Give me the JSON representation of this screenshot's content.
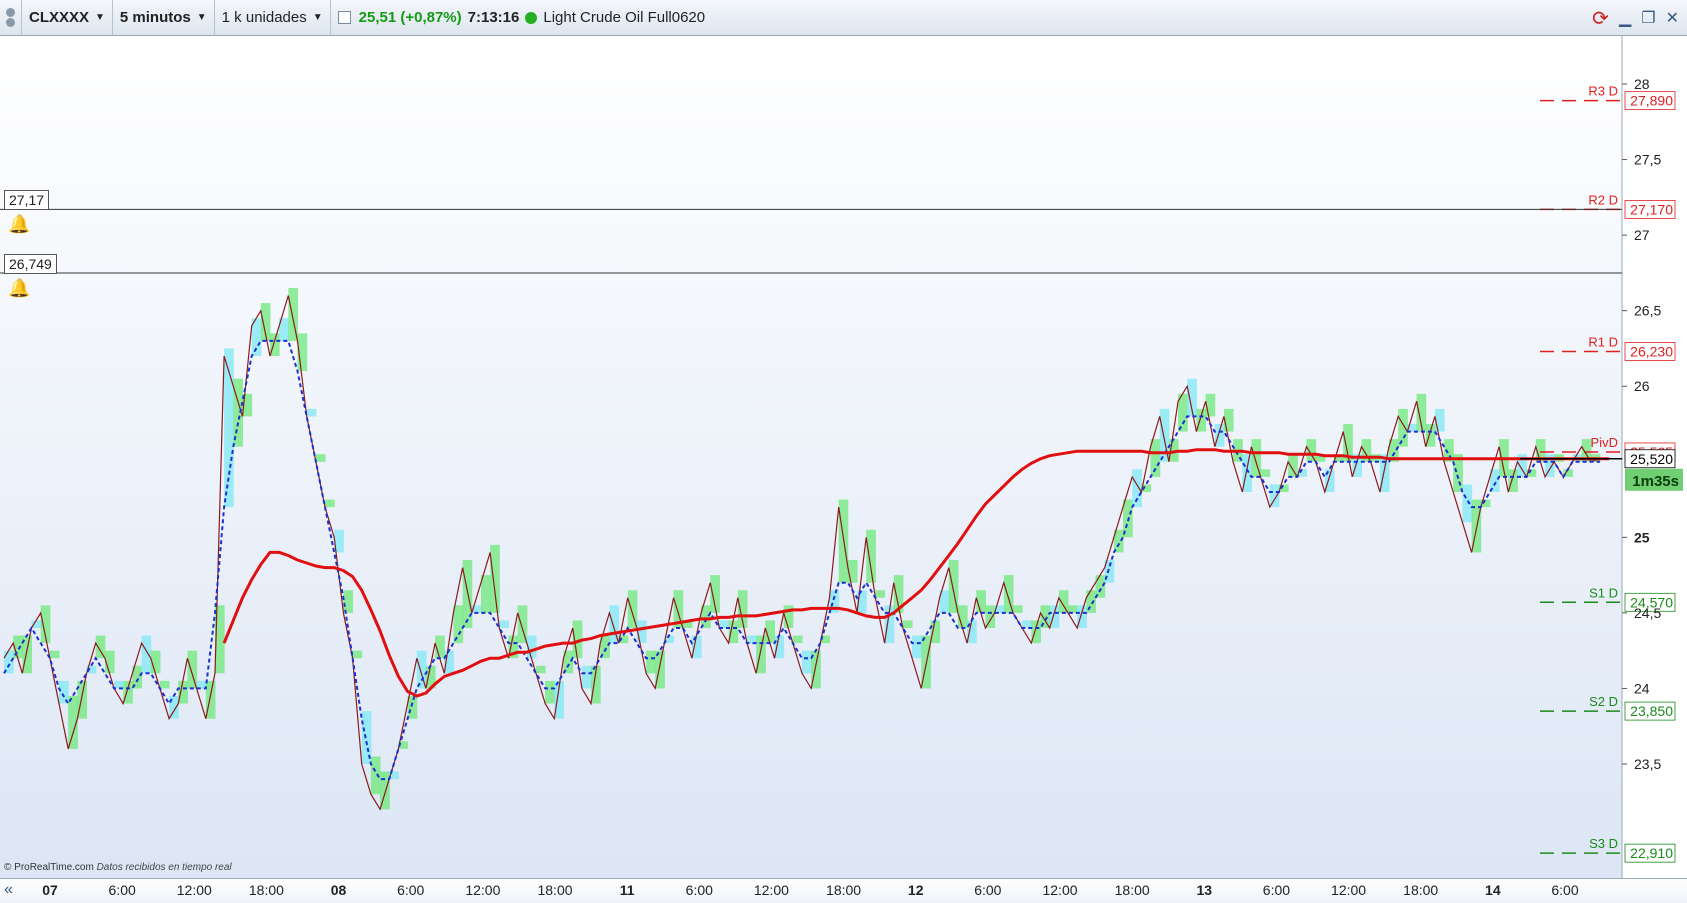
{
  "toolbar": {
    "symbol": "CLXXXX",
    "timeframe": "5 minutos",
    "units": "1 k unidades",
    "price_change": "25,51 (+0,87%)",
    "time": "7:13:16",
    "instrument": "Light Crude Oil Full0620"
  },
  "icons": {
    "grip": "grip-icon",
    "status": "green-dot-icon",
    "refresh": "refresh-icon",
    "minimize": "minimize-icon",
    "restore": "restore-icon",
    "close": "close-icon",
    "bell": "bell-icon",
    "scroll_left": "double-chevron-left-icon"
  },
  "alerts": [
    {
      "value": "27,17",
      "price": 27.17
    },
    {
      "value": "26,749",
      "price": 26.749
    }
  ],
  "credit": {
    "brand": "© ProRealTime.com",
    "note": "Datos recibidos en tiempo real"
  },
  "countdown": "1m35s",
  "colors": {
    "price_line": "#8b1a1a",
    "ma_red": "#e01010",
    "ma_blue": "#1c2fd0",
    "cloud_green": "#6ee87a",
    "cloud_cyan": "#7fe8f5",
    "pivot_red": "#e02020",
    "pivot_green": "#1a8a1a"
  },
  "chart_data": {
    "type": "line",
    "title": "",
    "ylim": [
      22.8,
      28.5
    ],
    "y_ticks": [
      "28",
      "27,5",
      "27",
      "26,5",
      "26",
      "25",
      "24,5",
      "24",
      "23,5"
    ],
    "x_ticks": [
      "07",
      "6:00",
      "12:00",
      "18:00",
      "08",
      "6:00",
      "12:00",
      "18:00",
      "11",
      "6:00",
      "12:00",
      "18:00",
      "12",
      "6:00",
      "12:00",
      "18:00",
      "13",
      "6:00",
      "12:00",
      "18:00",
      "14",
      "6:00"
    ],
    "x_tick_bold": [
      true,
      false,
      false,
      false,
      true,
      false,
      false,
      false,
      true,
      false,
      false,
      false,
      true,
      false,
      false,
      false,
      true,
      false,
      false,
      false,
      true,
      false
    ],
    "pivots": [
      {
        "name": "R3 D",
        "value": "27,890",
        "price": 27.89,
        "color": "red"
      },
      {
        "name": "R2 D",
        "value": "27,170",
        "price": 27.17,
        "color": "red"
      },
      {
        "name": "R1 D",
        "value": "26,230",
        "price": 26.23,
        "color": "red"
      },
      {
        "name": "PivD",
        "value": "25,565",
        "price": 25.565,
        "color": "red"
      },
      {
        "name": "S1 D",
        "value": "24,570",
        "price": 24.57,
        "color": "green"
      },
      {
        "name": "S2 D",
        "value": "23,850",
        "price": 23.85,
        "color": "green"
      },
      {
        "name": "S3 D",
        "value": "22,910",
        "price": 22.91,
        "color": "green"
      }
    ],
    "last_price": {
      "label": "25,520",
      "value": 25.52
    },
    "series": [
      {
        "key": "price",
        "y": [
          24.2,
          24.3,
          24.1,
          24.4,
          24.5,
          24.2,
          23.9,
          23.6,
          23.8,
          24.1,
          24.3,
          24.2,
          24.0,
          23.9,
          24.1,
          24.3,
          24.2,
          24.0,
          23.8,
          23.9,
          24.2,
          24.0,
          23.8,
          24.1,
          26.2,
          26.0,
          25.8,
          26.4,
          26.5,
          26.2,
          26.4,
          26.6,
          26.3,
          25.8,
          25.5,
          25.2,
          25.0,
          24.5,
          24.2,
          23.5,
          23.3,
          23.2,
          23.4,
          23.6,
          23.9,
          24.2,
          24.0,
          24.3,
          24.1,
          24.5,
          24.8,
          24.5,
          24.7,
          24.9,
          24.4,
          24.2,
          24.5,
          24.3,
          24.1,
          23.9,
          23.8,
          24.2,
          24.4,
          24.0,
          23.9,
          24.3,
          24.5,
          24.3,
          24.6,
          24.4,
          24.1,
          24.0,
          24.3,
          24.6,
          24.4,
          24.2,
          24.5,
          24.7,
          24.4,
          24.3,
          24.6,
          24.3,
          24.1,
          24.4,
          24.2,
          24.5,
          24.3,
          24.1,
          24.0,
          24.3,
          24.6,
          25.2,
          24.8,
          24.5,
          25.0,
          24.6,
          24.3,
          24.7,
          24.4,
          24.2,
          24.0,
          24.3,
          24.6,
          24.8,
          24.5,
          24.3,
          24.6,
          24.4,
          24.5,
          24.7,
          24.5,
          24.4,
          24.3,
          24.5,
          24.4,
          24.6,
          24.5,
          24.4,
          24.6,
          24.7,
          24.8,
          25.0,
          25.2,
          25.4,
          25.3,
          25.6,
          25.8,
          25.5,
          25.9,
          26.0,
          25.7,
          25.9,
          25.6,
          25.8,
          25.5,
          25.3,
          25.6,
          25.4,
          25.2,
          25.3,
          25.5,
          25.4,
          25.6,
          25.5,
          25.3,
          25.5,
          25.7,
          25.4,
          25.6,
          25.5,
          25.3,
          25.6,
          25.8,
          25.7,
          25.9,
          25.6,
          25.8,
          25.5,
          25.3,
          25.1,
          24.9,
          25.2,
          25.4,
          25.6,
          25.3,
          25.5,
          25.4,
          25.6,
          25.4,
          25.5,
          25.4,
          25.5,
          25.6,
          25.5,
          25.52
        ]
      },
      {
        "key": "ma_blue",
        "y": [
          24.1,
          24.2,
          24.3,
          24.4,
          24.3,
          24.2,
          24.0,
          23.9,
          24.0,
          24.1,
          24.2,
          24.1,
          24.0,
          24.0,
          24.0,
          24.1,
          24.1,
          24.0,
          23.9,
          24.0,
          24.0,
          24.0,
          24.0,
          24.5,
          25.2,
          25.6,
          25.9,
          26.2,
          26.3,
          26.3,
          26.3,
          26.3,
          26.1,
          25.8,
          25.5,
          25.2,
          24.9,
          24.6,
          24.2,
          23.8,
          23.5,
          23.4,
          23.4,
          23.6,
          23.8,
          24.0,
          24.1,
          24.2,
          24.2,
          24.3,
          24.4,
          24.5,
          24.5,
          24.5,
          24.4,
          24.3,
          24.3,
          24.2,
          24.1,
          24.0,
          24.0,
          24.1,
          24.2,
          24.1,
          24.1,
          24.2,
          24.3,
          24.3,
          24.4,
          24.3,
          24.2,
          24.2,
          24.3,
          24.4,
          24.4,
          24.3,
          24.4,
          24.5,
          24.4,
          24.4,
          24.4,
          24.3,
          24.3,
          24.3,
          24.3,
          24.4,
          24.3,
          24.2,
          24.2,
          24.3,
          24.5,
          24.7,
          24.7,
          24.6,
          24.7,
          24.6,
          24.5,
          24.5,
          24.4,
          24.3,
          24.3,
          24.4,
          24.5,
          24.5,
          24.4,
          24.4,
          24.5,
          24.5,
          24.5,
          24.5,
          24.5,
          24.4,
          24.4,
          24.4,
          24.5,
          24.5,
          24.5,
          24.5,
          24.5,
          24.6,
          24.7,
          24.9,
          25.0,
          25.2,
          25.3,
          25.4,
          25.5,
          25.6,
          25.7,
          25.8,
          25.8,
          25.8,
          25.7,
          25.7,
          25.6,
          25.5,
          25.4,
          25.4,
          25.3,
          25.3,
          25.4,
          25.4,
          25.5,
          25.5,
          25.4,
          25.5,
          25.5,
          25.5,
          25.5,
          25.5,
          25.5,
          25.5,
          25.6,
          25.7,
          25.7,
          25.7,
          25.7,
          25.6,
          25.5,
          25.3,
          25.2,
          25.2,
          25.3,
          25.4,
          25.4,
          25.4,
          25.4,
          25.5,
          25.5,
          25.5,
          25.4,
          25.5,
          25.5,
          25.5,
          25.5
        ]
      },
      {
        "key": "ma_red",
        "start_index": 24,
        "y": [
          24.3,
          24.45,
          24.6,
          24.72,
          24.82,
          24.9,
          24.9,
          24.88,
          24.85,
          24.83,
          24.81,
          24.8,
          24.8,
          24.78,
          24.74,
          24.65,
          24.52,
          24.38,
          24.22,
          24.08,
          23.98,
          23.95,
          23.97,
          24.03,
          24.08,
          24.1,
          24.12,
          24.15,
          24.18,
          24.2,
          24.2,
          24.22,
          24.24,
          24.24,
          24.26,
          24.28,
          24.29,
          24.3,
          24.3,
          24.32,
          24.33,
          24.35,
          24.36,
          24.37,
          24.38,
          24.39,
          24.4,
          24.41,
          24.42,
          24.43,
          24.44,
          24.45,
          24.46,
          24.46,
          24.47,
          24.47,
          24.48,
          24.48,
          24.48,
          24.49,
          24.5,
          24.51,
          24.52,
          24.52,
          24.53,
          24.53,
          24.53,
          24.53,
          24.52,
          24.5,
          24.48,
          24.47,
          24.47,
          24.5,
          24.55,
          24.6,
          24.65,
          24.72,
          24.8,
          24.88,
          24.96,
          25.05,
          25.14,
          25.22,
          25.28,
          25.34,
          25.4,
          25.45,
          25.49,
          25.52,
          25.54,
          25.55,
          25.56,
          25.57,
          25.57,
          25.57,
          25.57,
          25.57,
          25.57,
          25.57,
          25.57,
          25.56,
          25.56,
          25.56,
          25.57,
          25.57,
          25.58,
          25.58,
          25.58,
          25.57,
          25.57,
          25.57,
          25.56,
          25.56,
          25.56,
          25.56,
          25.55,
          25.55,
          25.55,
          25.55,
          25.54,
          25.54,
          25.54,
          25.53,
          25.53,
          25.53,
          25.53,
          25.52,
          25.52,
          25.52,
          25.52,
          25.52,
          25.52,
          25.52,
          25.52,
          25.52,
          25.52,
          25.52,
          25.52,
          25.52,
          25.52,
          25.52,
          25.52,
          25.52,
          25.52,
          25.52,
          25.52,
          25.52,
          25.52,
          25.52,
          25.52,
          25.52
        ]
      }
    ]
  }
}
